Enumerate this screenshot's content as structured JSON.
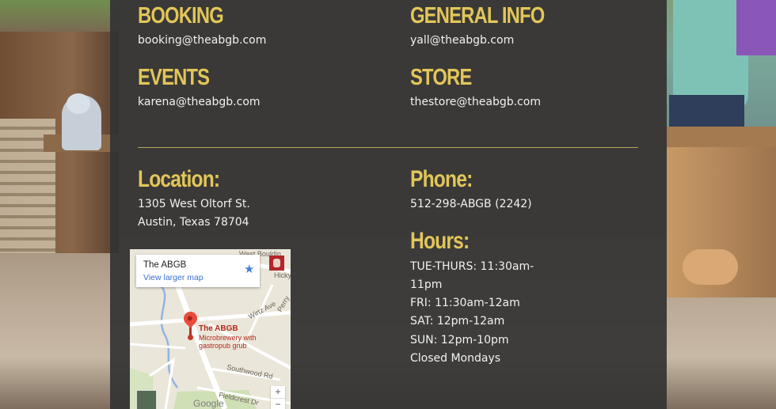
{
  "contacts": [
    {
      "heading": "BOOKING",
      "email": "booking@theabgb.com"
    },
    {
      "heading": "GENERAL INFO",
      "email": "yall@theabgb.com"
    },
    {
      "heading": "EVENTS",
      "email": "karena@theabgb.com"
    },
    {
      "heading": "STORE",
      "email": "thestore@theabgb.com"
    }
  ],
  "location": {
    "heading": "Location:",
    "address_line1": "1305 West Oltorf St.",
    "address_line2": "Austin, Texas 78704"
  },
  "phone": {
    "heading": "Phone:",
    "number": "512-298-ABGB (2242)"
  },
  "hours": {
    "heading": "Hours:",
    "lines": [
      "TUE-THURS: 11:30am-",
      "11pm",
      "FRI: 11:30am-12am",
      "SAT: 12pm-12am",
      "SUN: 12pm-10pm",
      "Closed Mondays"
    ]
  },
  "map": {
    "card_title": "The ABGB",
    "card_link": "View larger map",
    "place_name": "The ABGB",
    "place_desc": "Microbrewery with gastropub grub",
    "streets": [
      "West Bouldin",
      "Wirtz Ave",
      "Southwood Rd",
      "Fieldcrest Dr",
      "Perry",
      "Hicky"
    ],
    "zoom_in": "+",
    "zoom_out": "−",
    "google_logo": "Google"
  },
  "colors": {
    "heading_gold": "#e2c659",
    "panel_bg": "#343434",
    "divider": "#b3a458",
    "map_link_blue": "#3a6fd0",
    "map_pin_red": "#e84c3d"
  },
  "icons": [
    "star-icon",
    "map-pin-icon",
    "zoom-in-icon",
    "zoom-out-icon",
    "street-view-icon"
  ]
}
